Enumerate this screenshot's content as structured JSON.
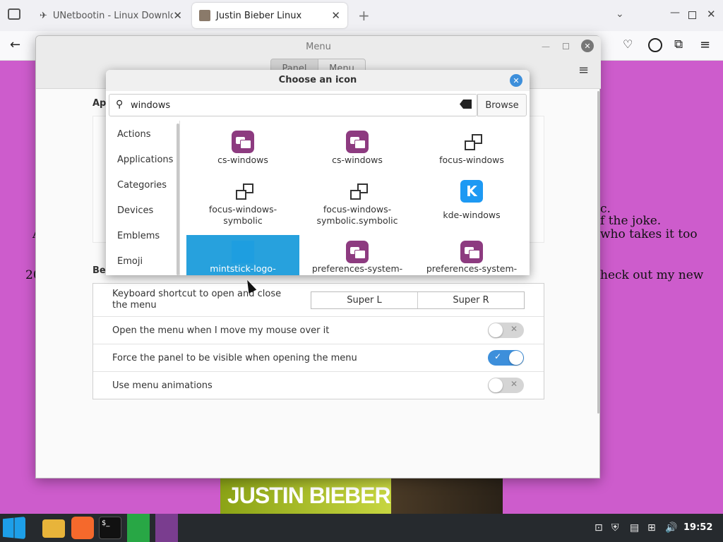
{
  "browser": {
    "tabs": [
      {
        "label": "UNetbootin - Linux Downlo"
      },
      {
        "label": "Justin Bieber Linux"
      }
    ],
    "new_tab": "+"
  },
  "page": {
    "text_lines": [
      "c.",
      "f the joke.",
      "who takes it too",
      "heck out my new"
    ],
    "left_frag_1": "A",
    "left_frag_2": "20",
    "banner_text": "JUSTIN BIEBER"
  },
  "settings_window": {
    "title": "Menu",
    "tabs": [
      "Panel",
      "Menu"
    ],
    "section_1_label": "App",
    "section_2_label": "Beh",
    "rows": [
      {
        "label": "Keyboard shortcut to open and close the menu",
        "keys": [
          "Super L",
          "Super R"
        ]
      },
      {
        "label": "Open the menu when I move my mouse over it",
        "toggle": "off"
      },
      {
        "label": "Force the panel to be visible when opening the menu",
        "toggle": "on"
      },
      {
        "label": "Use menu animations",
        "toggle": "off"
      }
    ]
  },
  "icon_dialog": {
    "title": "Choose an icon",
    "search_value": "windows",
    "browse_label": "Browse",
    "categories": [
      "Actions",
      "Applications",
      "Categories",
      "Devices",
      "Emblems",
      "Emoji"
    ],
    "icons": [
      {
        "label": "cs-windows",
        "icon": "cs-windows-icon"
      },
      {
        "label": "cs-windows",
        "icon": "cs-windows-icon"
      },
      {
        "label": "focus-windows",
        "icon": "focus-windows-icon"
      },
      {
        "label": "focus-windows-\nsymbolic",
        "icon": "focus-windows-symbolic-icon"
      },
      {
        "label": "focus-windows-\nsymbolic.symbolic",
        "icon": "focus-windows-symbolic-icon"
      },
      {
        "label": "kde-windows",
        "icon": "kde-windows-icon"
      },
      {
        "label": "mintstick-logo-",
        "icon": "mintstick-logo-icon",
        "selected": true
      },
      {
        "label": "preferences-system-",
        "icon": "preferences-system-icon"
      },
      {
        "label": "preferences-system-",
        "icon": "preferences-system-icon"
      }
    ]
  },
  "taskbar": {
    "clock": "19:52"
  },
  "colors": {
    "page_bg": "#cd5ccc",
    "accent": "#3d8fdb",
    "selection": "#27a1dd",
    "taskbar": "#262a2e"
  }
}
